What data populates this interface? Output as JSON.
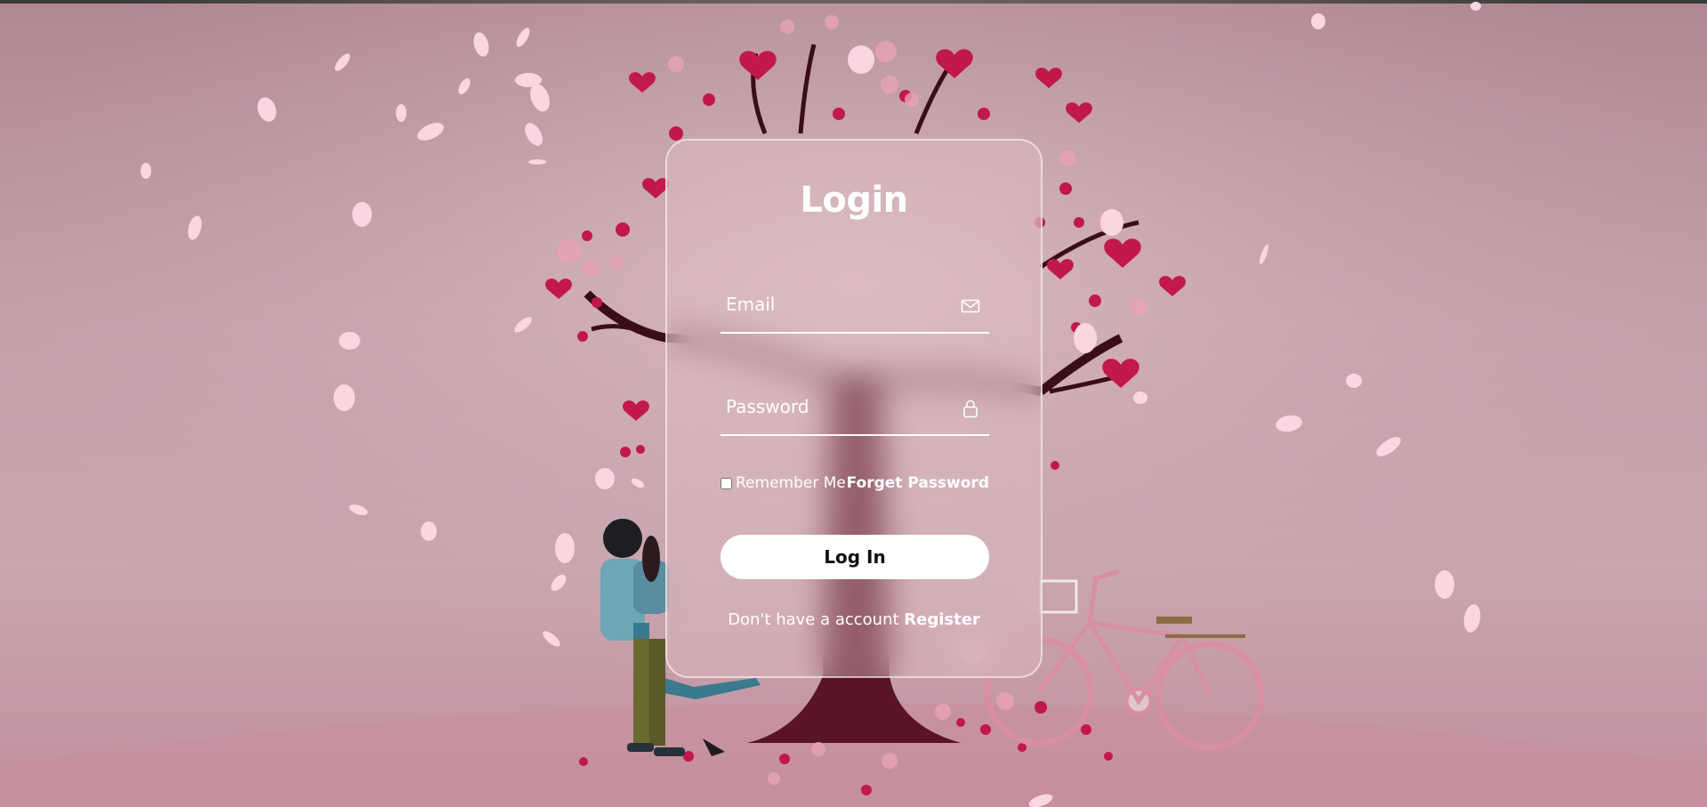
{
  "form": {
    "title": "Login",
    "email_placeholder": "Email",
    "password_placeholder": "Password",
    "remember_label": "Remember Me",
    "forgot_label": "Forget Password",
    "login_label": "Log In",
    "no_account_text": "Don't have a account",
    "register_label": "Register"
  },
  "icons": {
    "email": "envelope-icon",
    "password": "padlock-icon"
  },
  "colors": {
    "background": "#c4a1aa",
    "heart": "#c2184a",
    "petal": "#f7d3de",
    "button_bg": "#ffffff",
    "button_text": "#111111"
  }
}
